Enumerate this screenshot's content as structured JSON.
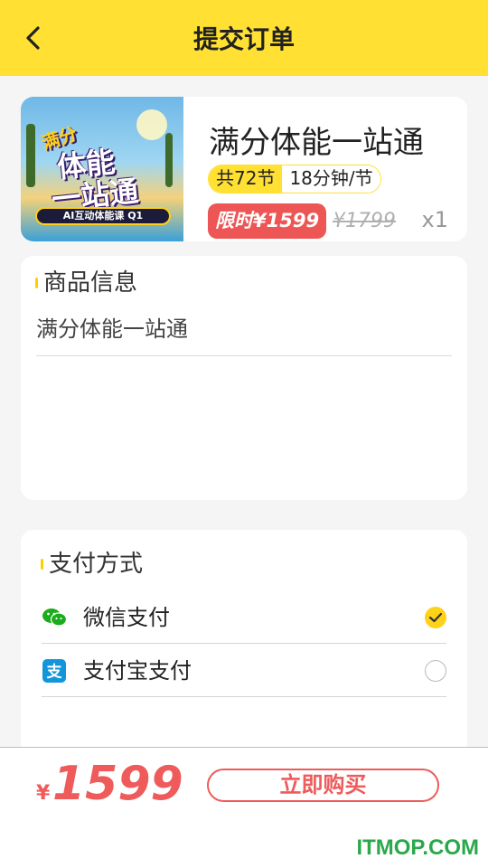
{
  "header": {
    "title": "提交订单",
    "back_icon": "chevron-left-icon",
    "background_color": "#ffe033"
  },
  "product": {
    "thumbnail": {
      "line1": "满分",
      "line2": "体能",
      "line3": "一站通",
      "tag": "AI互动体能课 Q1"
    },
    "name": "满分体能一站通",
    "lesson_count": "共72节",
    "lesson_length": "18分钟/节",
    "sale_price": "限时¥1599",
    "original_price": "¥1799",
    "quantity": "x1",
    "price_color": "#ee5555"
  },
  "product_info": {
    "title": "商品信息",
    "value": "满分体能一站通"
  },
  "payment": {
    "title": "支付方式",
    "methods": [
      {
        "label": "微信支付",
        "icon": "wechat-icon",
        "selected": true
      },
      {
        "label": "支付宝支付",
        "icon": "alipay-icon",
        "selected": false
      }
    ]
  },
  "footer": {
    "currency": "¥",
    "total": "1599",
    "buy_label": "立即购买"
  },
  "watermark": "ITMOP.COM",
  "colors": {
    "accent_yellow": "#ffd21a",
    "accent_red": "#ef5b5b",
    "watermark_green": "#2aa84a"
  }
}
